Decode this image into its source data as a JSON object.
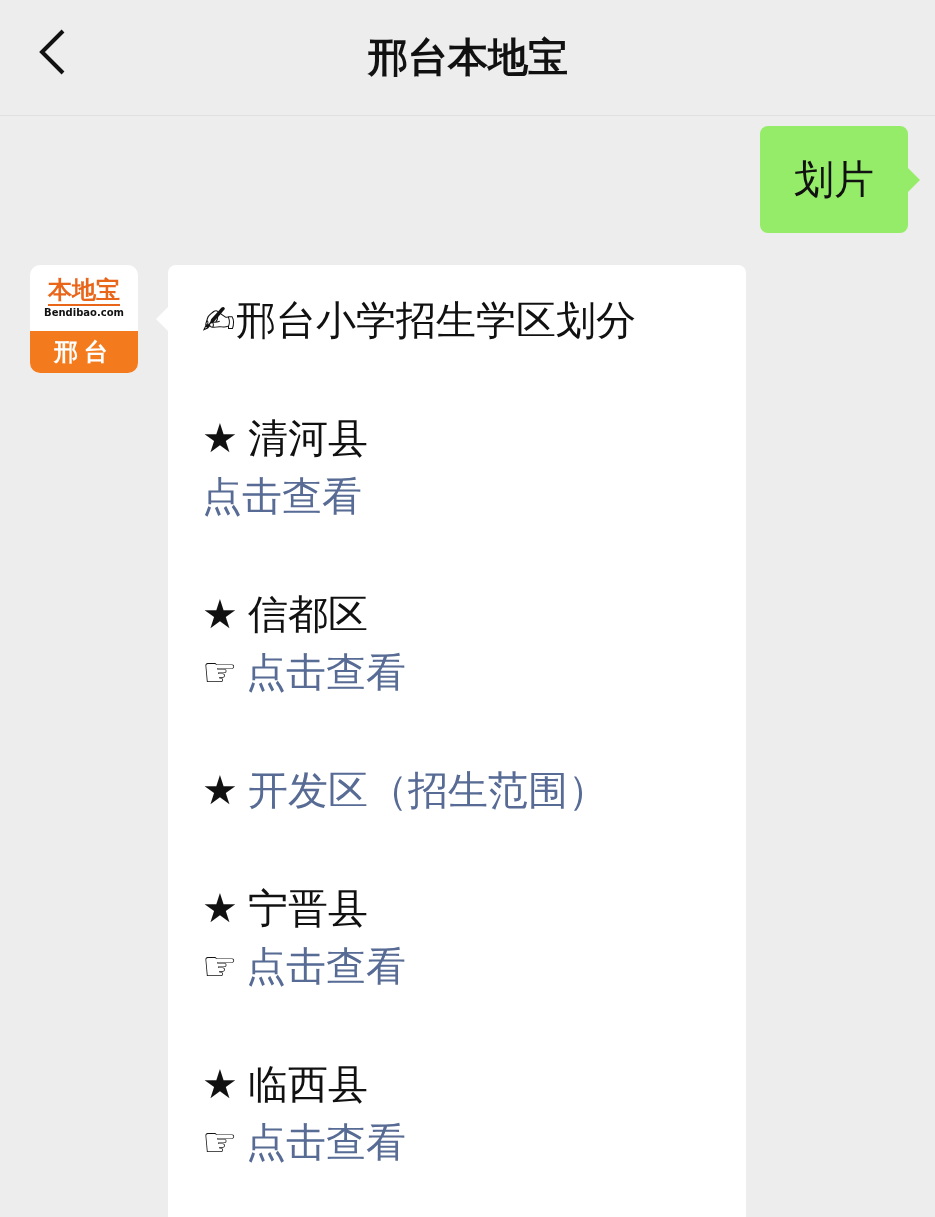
{
  "header": {
    "title": "邢台本地宝"
  },
  "outgoing": {
    "text": "划片"
  },
  "incoming": {
    "avatar": {
      "brand": "本地宝",
      "domain": "Bendibao.com",
      "city": "邢台"
    },
    "title": "✍邢台小学招生学区划分",
    "sections": [
      {
        "star": "★",
        "name": "清河县",
        "kind": "text",
        "link": {
          "text": "点击查看"
        }
      },
      {
        "star": "★",
        "name": "信都区",
        "kind": "text",
        "link": {
          "pointer": "☞",
          "text": "点击查看"
        }
      },
      {
        "star": "★",
        "name": "开发区（招生范围）",
        "kind": "link"
      },
      {
        "star": "★",
        "name": "宁晋县",
        "kind": "text",
        "link": {
          "pointer": "☞",
          "text": "点击查看"
        }
      },
      {
        "star": "★",
        "name": "临西县",
        "kind": "text",
        "link": {
          "pointer": "☞",
          "text": "点击查看"
        }
      }
    ]
  }
}
